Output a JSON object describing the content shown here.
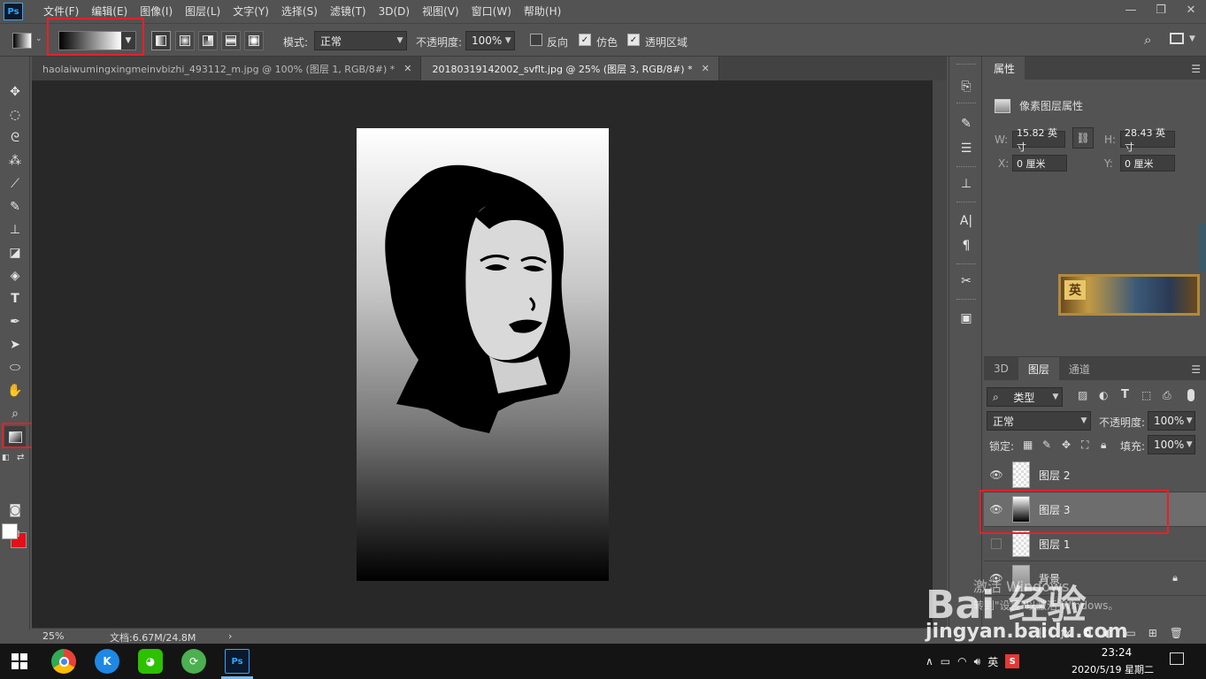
{
  "app": {
    "logo": "Ps",
    "menu": [
      "文件(F)",
      "编辑(E)",
      "图像(I)",
      "图层(L)",
      "文字(Y)",
      "选择(S)",
      "滤镜(T)",
      "3D(D)",
      "视图(V)",
      "窗口(W)",
      "帮助(H)"
    ],
    "window_controls": [
      "—",
      "❐",
      "✕"
    ]
  },
  "options": {
    "mode_label": "模式:",
    "mode_value": "正常",
    "opacity_label": "不透明度:",
    "opacity_value": "100%",
    "reverse_label": "反向",
    "dither_label": "仿色",
    "transparency_label": "透明区域",
    "reverse_checked": false,
    "dither_checked": true,
    "transparency_checked": true
  },
  "tabs": [
    {
      "title": "haolaiwumingxingmeinvbizhi_493112_m.jpg @ 100% (图层 1, RGB/8#) *",
      "close": "✕"
    },
    {
      "title": "20180319142002_svflt.jpg @ 25% (图层 3, RGB/8#) *",
      "close": "✕"
    }
  ],
  "status": {
    "zoom": "25%",
    "doc_info": "文档:6.67M/24.8M",
    "arrow": "›"
  },
  "properties": {
    "tab_label": "属性",
    "section_title": "像素图层属性",
    "w_label": "W:",
    "w_value": "15.82 英寸",
    "h_label": "H:",
    "h_value": "28.43 英寸",
    "x_label": "X:",
    "x_value": "0 厘米",
    "y_label": "Y:",
    "y_value": "0 厘米"
  },
  "banner": {
    "glyph": "英"
  },
  "layers": {
    "tabs": [
      "3D",
      "图层",
      "通道"
    ],
    "filter_value": "类型",
    "blend_mode": "正常",
    "opacity_label": "不透明度:",
    "opacity_value": "100%",
    "lock_label": "锁定:",
    "fill_label": "填充:",
    "fill_value": "100%",
    "items": [
      {
        "name": "图层 2",
        "visible": true
      },
      {
        "name": "图层 3",
        "visible": true,
        "selected": true
      },
      {
        "name": "图层 1",
        "visible": false
      },
      {
        "name": "背景",
        "visible": true,
        "locked": true
      }
    ]
  },
  "watermark": {
    "activate_line1": "激活 Windows",
    "activate_line2": "转到\"设置\"以激活 Windows。",
    "brand": "Bai 经验",
    "url": "jingyan.baidu.com"
  },
  "taskbar": {
    "input_method": "英",
    "time": "23:24",
    "date": "2020/5/19 星期二"
  },
  "colors": {
    "highlight": "#e8202a",
    "foreground": "#ffffff",
    "background": "#e3101a"
  }
}
